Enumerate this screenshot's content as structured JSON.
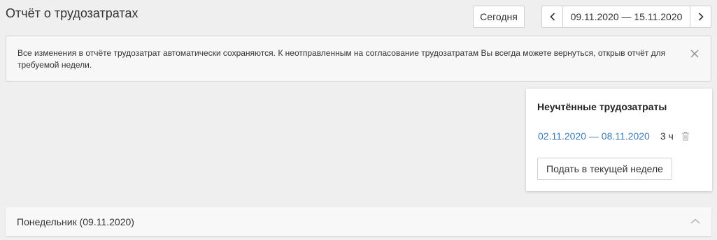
{
  "page": {
    "title": "Отчёт о трудозатратах"
  },
  "toolbar": {
    "today_label": "Сегодня",
    "week_range": "09.11.2020 — 15.11.2020",
    "prev_icon": "chevron-left-icon",
    "next_icon": "chevron-right-icon"
  },
  "notice": {
    "text": "Все изменения в отчёте трудозатрат автоматически сохраняются. К неотправленным на согласование трудозатратам Вы всегда можете вернуться, открыв отчёт для требуемой недели.",
    "close_icon": "close-icon"
  },
  "unaccounted": {
    "title": "Неучтённые трудозатраты",
    "items": [
      {
        "period": "02.11.2020 — 08.11.2020",
        "hours": "3 ч",
        "delete_icon": "trash-icon"
      }
    ],
    "submit_label": "Подать в текущей неделе"
  },
  "days": [
    {
      "label": "Понедельник (09.11.2020)",
      "expanded": true,
      "toggle_icon": "chevron-up-icon"
    }
  ],
  "colors": {
    "background": "#efefef",
    "link": "#3a7ab8",
    "border": "#cfcfcf",
    "panel": "#f8f8f8"
  }
}
